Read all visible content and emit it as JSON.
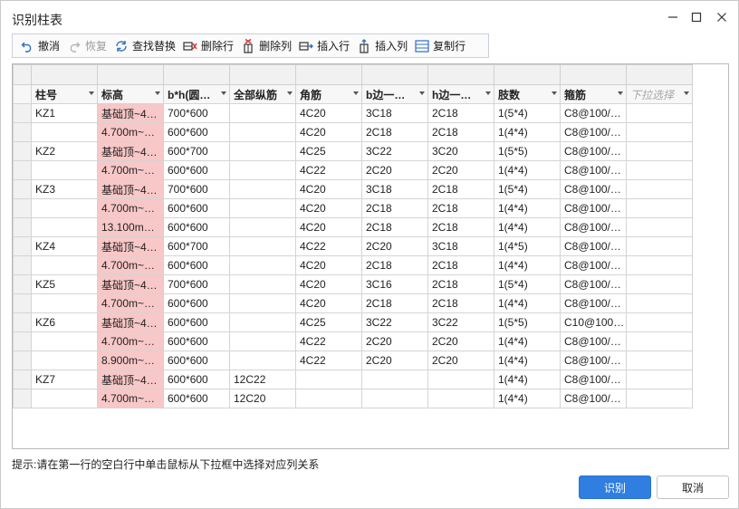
{
  "window": {
    "title": "识别柱表"
  },
  "toolbar": {
    "undo": {
      "label": "撤消",
      "icon": "undo-icon"
    },
    "redo": {
      "label": "恢复",
      "icon": "redo-icon"
    },
    "find_replace": {
      "label": "查找替换",
      "icon": "find-replace-icon"
    },
    "delete_row": {
      "label": "删除行",
      "icon": "delete-row-icon"
    },
    "delete_col": {
      "label": "删除列",
      "icon": "delete-column-icon"
    },
    "insert_row": {
      "label": "插入行",
      "icon": "insert-row-icon"
    },
    "insert_col": {
      "label": "插入列",
      "icon": "insert-column-icon"
    },
    "copy_row": {
      "label": "复制行",
      "icon": "copy-row-icon"
    }
  },
  "grid": {
    "headers": [
      "柱号",
      "标高",
      "b*h(圆…",
      "全部纵筋",
      "角筋",
      "b边一…",
      "h边一…",
      "肢数",
      "箍筋",
      "下拉选择"
    ],
    "rows": [
      [
        "KZ1",
        "基础顶~4…",
        "700*600",
        "",
        "4C20",
        "3C18",
        "2C18",
        "1(5*4)",
        "C8@100/…",
        ""
      ],
      [
        "",
        "4.700m~…",
        "600*600",
        "",
        "4C20",
        "2C18",
        "2C18",
        "1(4*4)",
        "C8@100/…",
        ""
      ],
      [
        "KZ2",
        "基础顶~4…",
        "600*700",
        "",
        "4C25",
        "3C22",
        "3C20",
        "1(5*5)",
        "C8@100/…",
        ""
      ],
      [
        "",
        "4.700m~…",
        "600*600",
        "",
        "4C22",
        "2C20",
        "2C20",
        "1(4*4)",
        "C8@100/…",
        ""
      ],
      [
        "KZ3",
        "基础顶~4…",
        "700*600",
        "",
        "4C20",
        "3C18",
        "2C18",
        "1(5*4)",
        "C8@100/…",
        ""
      ],
      [
        "",
        "4.700m~…",
        "600*600",
        "",
        "4C20",
        "2C18",
        "2C18",
        "1(4*4)",
        "C8@100/…",
        ""
      ],
      [
        "",
        "13.100m…",
        "600*600",
        "",
        "4C20",
        "2C18",
        "2C18",
        "1(4*4)",
        "C8@100/…",
        ""
      ],
      [
        "KZ4",
        "基础顶~4…",
        "600*700",
        "",
        "4C22",
        "2C20",
        "3C18",
        "1(4*5)",
        "C8@100/…",
        ""
      ],
      [
        "",
        "4.700m~…",
        "600*600",
        "",
        "4C20",
        "2C18",
        "2C18",
        "1(4*4)",
        "C8@100/…",
        ""
      ],
      [
        "KZ5",
        "基础顶~4…",
        "700*600",
        "",
        "4C20",
        "3C16",
        "2C18",
        "1(5*4)",
        "C8@100/…",
        ""
      ],
      [
        "",
        "4.700m~…",
        "600*600",
        "",
        "4C20",
        "2C18",
        "2C18",
        "1(4*4)",
        "C8@100/…",
        ""
      ],
      [
        "KZ6",
        "基础顶~4…",
        "600*600",
        "",
        "4C25",
        "3C22",
        "3C22",
        "1(5*5)",
        "C10@100…",
        ""
      ],
      [
        "",
        "4.700m~…",
        "600*600",
        "",
        "4C22",
        "2C20",
        "2C20",
        "1(4*4)",
        "C8@100/…",
        ""
      ],
      [
        "",
        "8.900m~…",
        "600*600",
        "",
        "4C22",
        "2C20",
        "2C20",
        "1(4*4)",
        "C8@100/…",
        ""
      ],
      [
        "KZ7",
        "基础顶~4…",
        "600*600",
        "12C22",
        "",
        "",
        "",
        "1(4*4)",
        "C8@100/…",
        ""
      ],
      [
        "",
        "4.700m~…",
        "600*600",
        "12C20",
        "",
        "",
        "",
        "1(4*4)",
        "C8@100/…",
        ""
      ]
    ]
  },
  "hint": "提示:请在第一行的空白行中单击鼠标从下拉框中选择对应列关系",
  "buttons": {
    "ok": "识别",
    "cancel": "取消"
  },
  "colors": {
    "highlight": "#f8c7c7",
    "primary": "#2f7ee0"
  }
}
